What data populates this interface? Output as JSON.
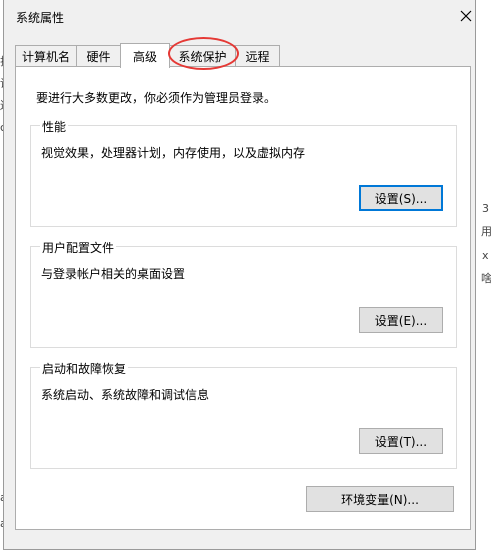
{
  "window": {
    "title": "系统属性"
  },
  "tabs": [
    {
      "label": "计算机名"
    },
    {
      "label": "硬件"
    },
    {
      "label": "高级"
    },
    {
      "label": "系统保护"
    },
    {
      "label": "远程"
    }
  ],
  "active_tab": "高级",
  "intro_text": "要进行大多数更改，你必须作为管理员登录。",
  "groups": {
    "performance": {
      "title": "性能",
      "desc": "视觉效果，处理器计划，内存使用，以及虚拟内存",
      "button": "设置(S)..."
    },
    "user_profiles": {
      "title": "用户配置文件",
      "desc": "与登录帐户相关的桌面设置",
      "button": "设置(E)..."
    },
    "startup_recovery": {
      "title": "启动和故障恢复",
      "desc": "系统启动、系统故障和调试信息",
      "button": "设置(T)..."
    }
  },
  "env_button": "环境变量(N)...",
  "annotation": {
    "color": "#e53935",
    "target": "系统保护"
  },
  "background_fragments": {
    "left": [
      "拉",
      "设",
      "送",
      "c",
      "a",
      "a"
    ],
    "right": [
      "3",
      "用",
      "x",
      "啥"
    ]
  }
}
